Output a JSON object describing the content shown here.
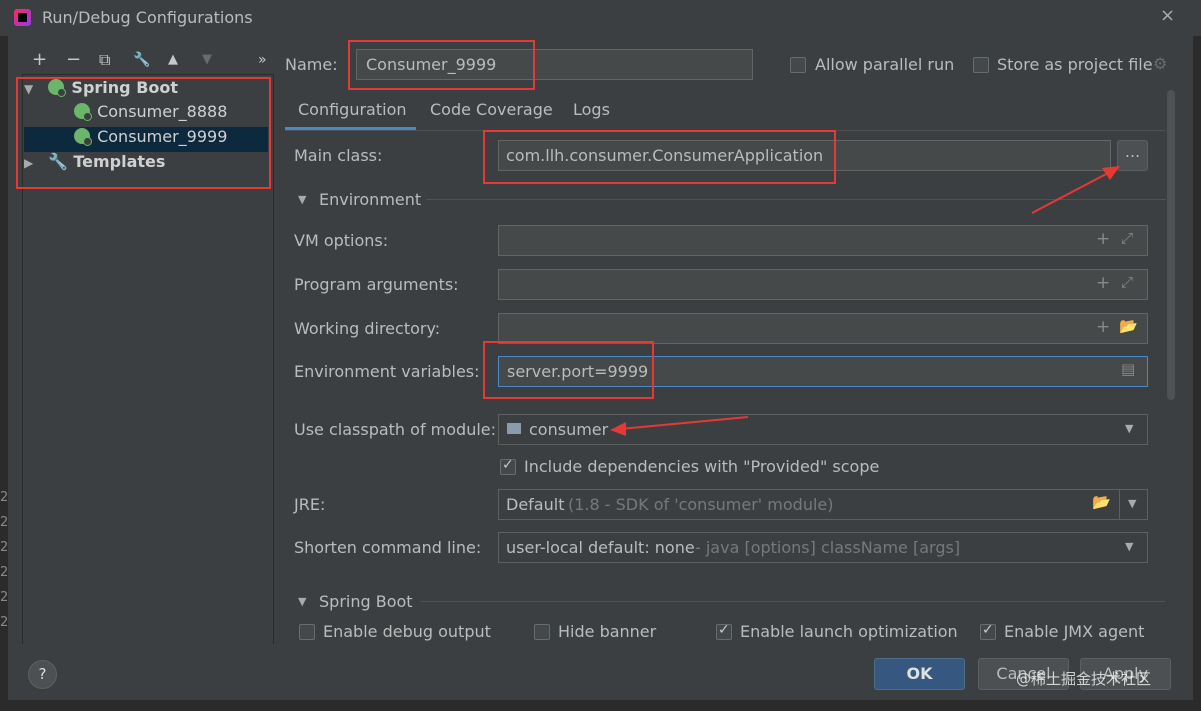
{
  "window": {
    "title": "Run/Debug Configurations",
    "close_glyph": "×"
  },
  "toolbar": {
    "add": "+",
    "remove": "−",
    "copy": "⧉",
    "edit": "🔧",
    "up": "▲",
    "down": "▼",
    "more": "»"
  },
  "tree": {
    "spring_boot": "Spring Boot",
    "items": [
      "Consumer_8888",
      "Consumer_9999"
    ],
    "templates": "Templates"
  },
  "header": {
    "name_label": "Name:",
    "name_value": "Consumer_9999",
    "allow_parallel": "Allow parallel run",
    "store_as_project": "Store as project file"
  },
  "tabs": [
    "Configuration",
    "Code Coverage",
    "Logs"
  ],
  "form": {
    "main_class_label": "Main class:",
    "main_class_value": "com.llh.consumer.ConsumerApplication",
    "browse": "...",
    "environment_section": "Environment",
    "vm_options_label": "VM options:",
    "program_args_label": "Program arguments:",
    "working_dir_label": "Working directory:",
    "env_vars_label": "Environment variables:",
    "env_vars_value": "server.port=9999",
    "classpath_label": "Use classpath of module:",
    "classpath_value": "consumer",
    "include_deps": "Include dependencies with \"Provided\" scope",
    "jre_label": "JRE:",
    "jre_value": "Default",
    "jre_hint": "(1.8 - SDK of 'consumer' module)",
    "shorten_label": "Shorten command line:",
    "shorten_value": "user-local default: none",
    "shorten_hint": "- java [options] className [args]",
    "spring_boot_section": "Spring Boot",
    "enable_debug": "Enable debug output",
    "hide_banner": "Hide banner",
    "enable_launch": "Enable launch optimization",
    "enable_jmx": "Enable JMX agent"
  },
  "footer": {
    "help": "?",
    "ok": "OK",
    "cancel": "Cancel",
    "apply": "Apply",
    "watermark": "@稀土掘金技术社区"
  },
  "colors": {
    "accent": "#4a88c7",
    "annotation_red": "#e53935",
    "primary_button": "#365880"
  }
}
